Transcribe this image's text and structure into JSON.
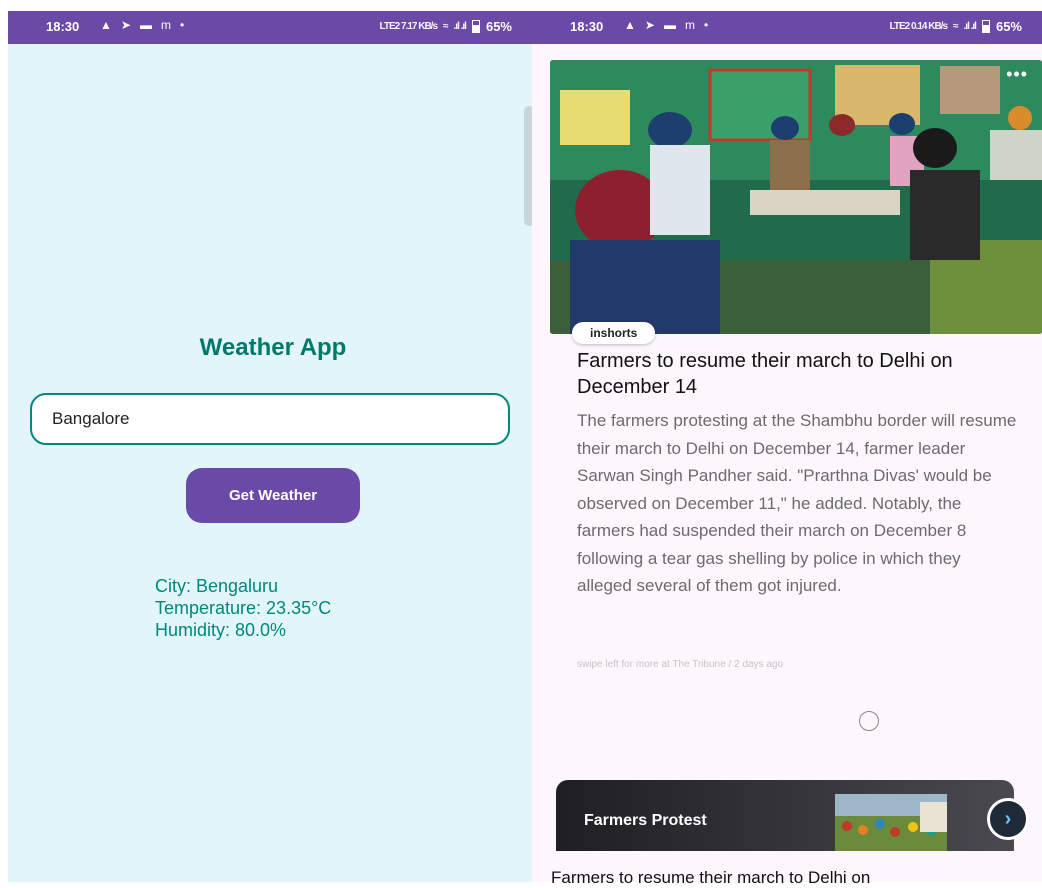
{
  "left_screen": {
    "status": {
      "time": "18:30",
      "network": "LTE2 7.17 KB/s",
      "battery": "65%"
    },
    "weather_app": {
      "title": "Weather App",
      "city_input_value": "Bangalore",
      "button_label": "Get Weather",
      "result_city": "City: Bengaluru",
      "result_temperature": "Temperature: 23.35°C",
      "result_humidity": "Humidity: 80.0%"
    }
  },
  "right_screen": {
    "status": {
      "time": "18:30",
      "network": "LTE2 0.14 KB/s",
      "battery": "65%"
    },
    "news_card": {
      "source_badge": "inshorts",
      "headline": "Farmers to resume their march to Delhi on December 14",
      "body": "The farmers protesting at the Shambhu border will resume their march to Delhi on December 14, farmer leader Sarwan Singh Pandher said. \"Prarthna Divas' would be observed on December 11,\" he added. Notably, the farmers had suspended their march on December 8 following a tear gas shelling by police in which they alleged several of them got injured.",
      "footer": "swipe left for more at The Tribune / 2 days ago"
    },
    "banner": {
      "title": "Farmers Protest"
    },
    "next_headline": "Farmers to resume their march to Delhi on"
  },
  "colors": {
    "statusbar": "#6a4aa6",
    "accent_teal": "#00796b",
    "button": "#6a4aa6",
    "weather_bg": "#e2f5fb"
  }
}
